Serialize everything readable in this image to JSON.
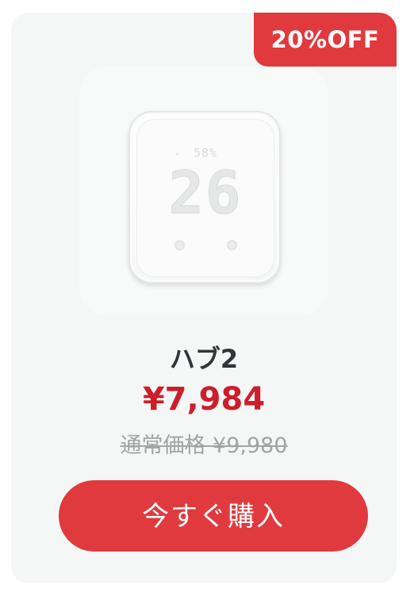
{
  "badge": {
    "label": "20%OFF",
    "color": "#e03a3e"
  },
  "product": {
    "image_alt_icon": "smart-hub-device",
    "display_humidity": "58%",
    "display_temperature": "26",
    "name": "ハブ2",
    "sale_price": "¥7,984",
    "regular_price": "通常価格 ¥9,980"
  },
  "cta": {
    "label": "今すぐ購入"
  },
  "colors": {
    "accent": "#e03a3e",
    "price": "#cc1f2a",
    "muted": "#a2a5a5",
    "card_bg": "#f5f6f6"
  }
}
